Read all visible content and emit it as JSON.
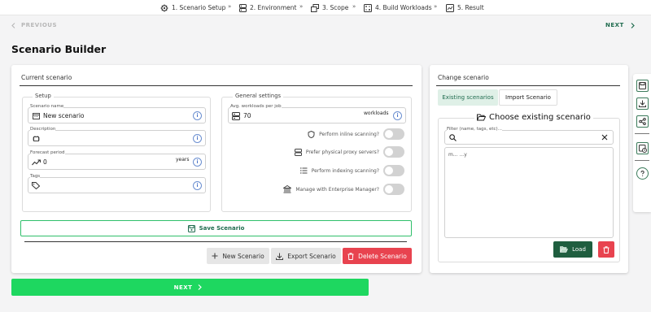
{
  "stepper": {
    "steps": [
      {
        "label": "1. Scenario Setup",
        "icon": "gear-icon"
      },
      {
        "label": "2. Environment",
        "icon": "server-icon"
      },
      {
        "label": "3. Scope",
        "icon": "layers-icon"
      },
      {
        "label": "4. Build Workloads",
        "icon": "calculator-icon"
      },
      {
        "label": "5. Result",
        "icon": "report-icon"
      }
    ],
    "separator": "»"
  },
  "nav": {
    "previous": "PREVIOUS",
    "next": "NEXT"
  },
  "page_title": "Scenario Builder",
  "current_scenario": {
    "title": "Current scenario",
    "setup": {
      "legend": "Setup",
      "scenario_name": {
        "label": "Scenario name",
        "value": "New scenario"
      },
      "description": {
        "label": "Description",
        "value": ""
      },
      "forecast_period": {
        "label": "Forecast period",
        "value": "0",
        "unit": "years"
      },
      "tags": {
        "label": "Tags",
        "value": ""
      }
    },
    "general_settings": {
      "legend": "General settings",
      "avg_workloads": {
        "label": "Avg. workloads per job",
        "value": "70",
        "unit": "workloads"
      },
      "toggles": [
        {
          "label": "Perform inline scanning?",
          "on": false
        },
        {
          "label": "Prefer physical proxy servers?",
          "on": false
        },
        {
          "label": "Perform indexing scanning?",
          "on": false
        },
        {
          "label": "Manage with Enterprise Manager?",
          "on": false
        }
      ]
    },
    "save_label": "Save Scenario",
    "new_label": "New Scenario",
    "export_label": "Export Scenario",
    "delete_label": "Delete Scenario"
  },
  "change_scenario": {
    "title": "Change scenario",
    "tabs": [
      {
        "label": "Existing scenarios",
        "active": true
      },
      {
        "label": "Import Scenario",
        "active": false
      }
    ],
    "choose_title": "Choose existing scenario",
    "filter_label": "Filter (name, tags, etc)...",
    "filter_value": "",
    "list_items": [
      "m... ...y"
    ],
    "load_label": "Load"
  },
  "bottom_next": "NEXT",
  "colors": {
    "accent": "#1f6b4e",
    "save_border": "#2fbf6a",
    "next_button": "#1ed760",
    "delete": "#e8434f",
    "load": "#1f5e3f"
  }
}
